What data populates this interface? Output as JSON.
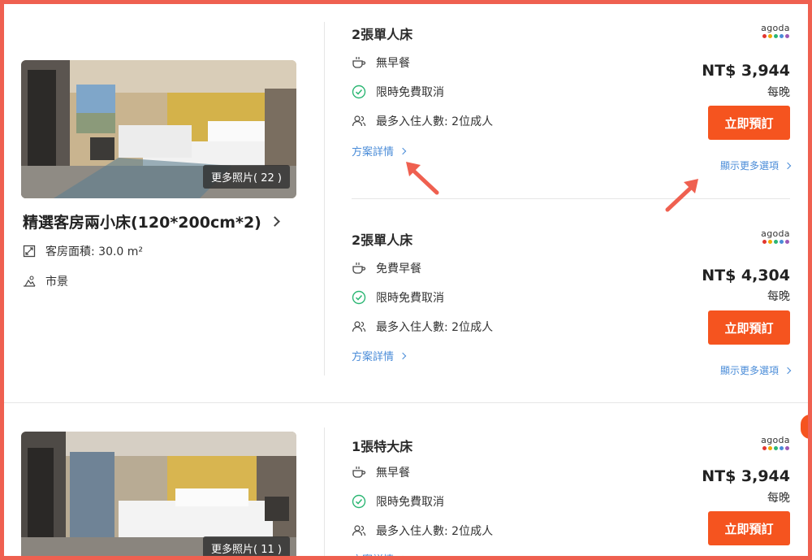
{
  "rooms": [
    {
      "name": "精選客房兩小床(120*200cm*2)",
      "photo_count": "更多照片( 22 )",
      "features": [
        {
          "icon": "area-icon",
          "text": "客房面積: 30.0 m²"
        },
        {
          "icon": "city-view-icon",
          "text": "市景"
        }
      ],
      "offers": [
        {
          "bed": "2張單人床",
          "meal": "無早餐",
          "cancel": "限時免費取消",
          "occupancy": "最多入住人數: 2位成人",
          "details": "方案詳情",
          "provider": "agoda",
          "price": "NT$ 3,944",
          "per_night": "每晚",
          "book": "立即預訂",
          "more": "顯示更多選項"
        },
        {
          "bed": "2張單人床",
          "meal": "免費早餐",
          "cancel": "限時免費取消",
          "occupancy": "最多入住人數: 2位成人",
          "details": "方案詳情",
          "provider": "agoda",
          "price": "NT$ 4,304",
          "per_night": "每晚",
          "book": "立即預訂",
          "more": "顯示更多選項"
        }
      ]
    },
    {
      "photo_count": "更多照片( 11 )",
      "offers": [
        {
          "bed": "1張特大床",
          "meal": "無早餐",
          "cancel": "限時免費取消",
          "occupancy": "最多入住人數: 2位成人",
          "details": "方案詳情",
          "provider": "agoda",
          "price": "NT$ 3,944",
          "per_night": "每晚",
          "book": "立即預訂"
        }
      ]
    }
  ],
  "colors": {
    "accent": "#f5541f",
    "link": "#4a8cd8",
    "frame": "#ef6050",
    "check": "#2bb673",
    "agoda_dots": [
      "#e2362f",
      "#f2a900",
      "#2bb673",
      "#4a8cd8",
      "#9b59b6"
    ]
  }
}
